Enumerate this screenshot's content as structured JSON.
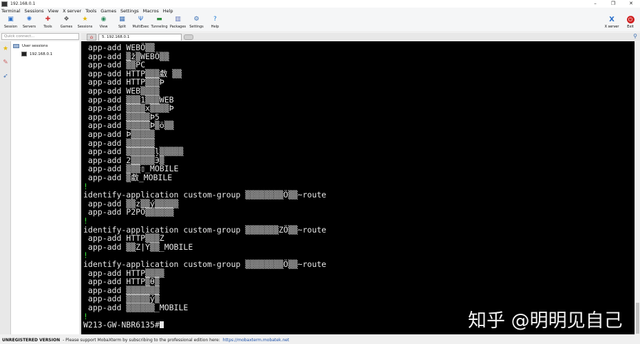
{
  "window": {
    "title": "192.168.0.1",
    "minimize": "–",
    "maximize": "❐",
    "close": "✕"
  },
  "menu": [
    "Terminal",
    "Sessions",
    "View",
    "X server",
    "Tools",
    "Games",
    "Settings",
    "Macros",
    "Help"
  ],
  "toolbar": {
    "buttons": [
      {
        "label": "Session",
        "icon": "session-icon",
        "glyph": "▣",
        "color": "#2a6fc9"
      },
      {
        "label": "Servers",
        "icon": "servers-icon",
        "glyph": "✺",
        "color": "#3a7bd5"
      },
      {
        "label": "Tools",
        "icon": "tools-icon",
        "glyph": "✚",
        "color": "#d03030"
      },
      {
        "label": "Games",
        "icon": "games-icon",
        "glyph": "❖",
        "color": "#555555"
      },
      {
        "label": "Sessions",
        "icon": "star-icon",
        "glyph": "★",
        "color": "#e6b800"
      },
      {
        "label": "View",
        "icon": "view-icon",
        "glyph": "◉",
        "color": "#2a8a5a"
      },
      {
        "label": "Split",
        "icon": "split-icon",
        "glyph": "▦",
        "color": "#3a6fb5"
      },
      {
        "label": "MultiExec",
        "icon": "multiexec-icon",
        "glyph": "Ψ",
        "color": "#2a6fc9"
      },
      {
        "label": "Tunneling",
        "icon": "tunneling-icon",
        "glyph": "▬",
        "color": "#2a8a3a"
      },
      {
        "label": "Packages",
        "icon": "packages-icon",
        "glyph": "▥",
        "color": "#5a6fb5"
      },
      {
        "label": "Settings",
        "icon": "gear-icon",
        "glyph": "⚙",
        "color": "#3a6fb5"
      },
      {
        "label": "Help",
        "icon": "help-icon",
        "glyph": "?",
        "color": "#1a7ad5"
      }
    ],
    "xserver": {
      "label": "X server",
      "glyph": "X",
      "color": "#2a6fc9"
    },
    "exit": {
      "label": "Exit",
      "glyph": "⏻",
      "color": "#d02020"
    }
  },
  "quick_connect": {
    "placeholder": "Quick connect..."
  },
  "tabs": {
    "active_label": "5. 192.168.0.1"
  },
  "sidebar": {
    "root": "User sessions",
    "session": "192.168.0.1"
  },
  "terminal": {
    "lines": [
      {
        "text": " app-add WEBÖ▒▒",
        "color": "white"
      },
      {
        "text": " app-add ▒ž▒WEBÖ▒▒",
        "color": "white"
      },
      {
        "text": " app-add ▒▒PC",
        "color": "white"
      },
      {
        "text": " app-add HTTP▒▒▒䲣 ▒▒",
        "color": "white"
      },
      {
        "text": " app-add HTTP▒▒▒Þ",
        "color": "white"
      },
      {
        "text": " app-add WEB▒▒▒▒",
        "color": "white"
      },
      {
        "text": " app-add ▒▒▒1▒▒▒WEB",
        "color": "white"
      },
      {
        "text": " app-add ▒▒▒▒x▒▒▒▒Þ",
        "color": "white"
      },
      {
        "text": " app-add ▒▒▒▒▒Þ5",
        "color": "white"
      },
      {
        "text": " app-add ▒▒▒▒▒Þ▒ö▒▒",
        "color": "white"
      },
      {
        "text": " app-add Þ▒▒▒▒▒",
        "color": "white"
      },
      {
        "text": " app-add ▒▒▒▒▒▒",
        "color": "white"
      },
      {
        "text": " app-add ▒▒▒▒▒▒ļ▒▒▒▒▒",
        "color": "white"
      },
      {
        "text": " app-add 2▒▒▒▒▒Э▒",
        "color": "white"
      },
      {
        "text": " app-add ▒▒▒▯_MOBILE",
        "color": "white"
      },
      {
        "text": " app-add ▒䲣_MOBILE",
        "color": "white"
      },
      {
        "text": "!",
        "color": "green"
      },
      {
        "text": "identify-application custom-group ▒▒▒▒▒▒▒▒Ö▒▒~route",
        "color": "white"
      },
      {
        "text": " app-add ▒▒z▒▒ý▒▒▒▒▒",
        "color": "white"
      },
      {
        "text": " app-add P2PÖ▒▒▒▒▒▒",
        "color": "white"
      },
      {
        "text": "!",
        "color": "green"
      },
      {
        "text": "identify-application custom-group ▒▒▒▒▒▒▒ZÖ▒▒~route",
        "color": "white"
      },
      {
        "text": " app-add HTTP▒▒▒Z",
        "color": "white"
      },
      {
        "text": " app-add ▒▒Z|Ý▒▒_MOBILE",
        "color": "white"
      },
      {
        "text": "!",
        "color": "green"
      },
      {
        "text": "identify-application custom-group ▒▒▒▒▒▒▒▒Ö▒▒~route",
        "color": "white"
      },
      {
        "text": " app-add HTTP▒▒▒▒",
        "color": "white"
      },
      {
        "text": " app-add HTTP▒θ▒",
        "color": "white"
      },
      {
        "text": " app-add ▒▒▒▒▒▒▒",
        "color": "white"
      },
      {
        "text": " app-add ▒▒▒▒▒ý▒",
        "color": "white"
      },
      {
        "text": " app-add ▒▒▒▒▒▒_MOBILE",
        "color": "white"
      },
      {
        "text": "!",
        "color": "green"
      },
      {
        "text": "W213-GW-NBR6135#",
        "color": "white",
        "cursor": true
      }
    ],
    "watermark": "知乎 @明明见自己"
  },
  "status": {
    "unregistered": "UNREGISTERED VERSION",
    "message": "- Please support MobaXterm by subscribing to the professional edition here:",
    "link": "https://mobaxterm.mobatek.net"
  },
  "colors": {
    "terminal_bg": "#000000",
    "terminal_fg": "#e8e8e8",
    "terminal_green": "#33e033"
  }
}
